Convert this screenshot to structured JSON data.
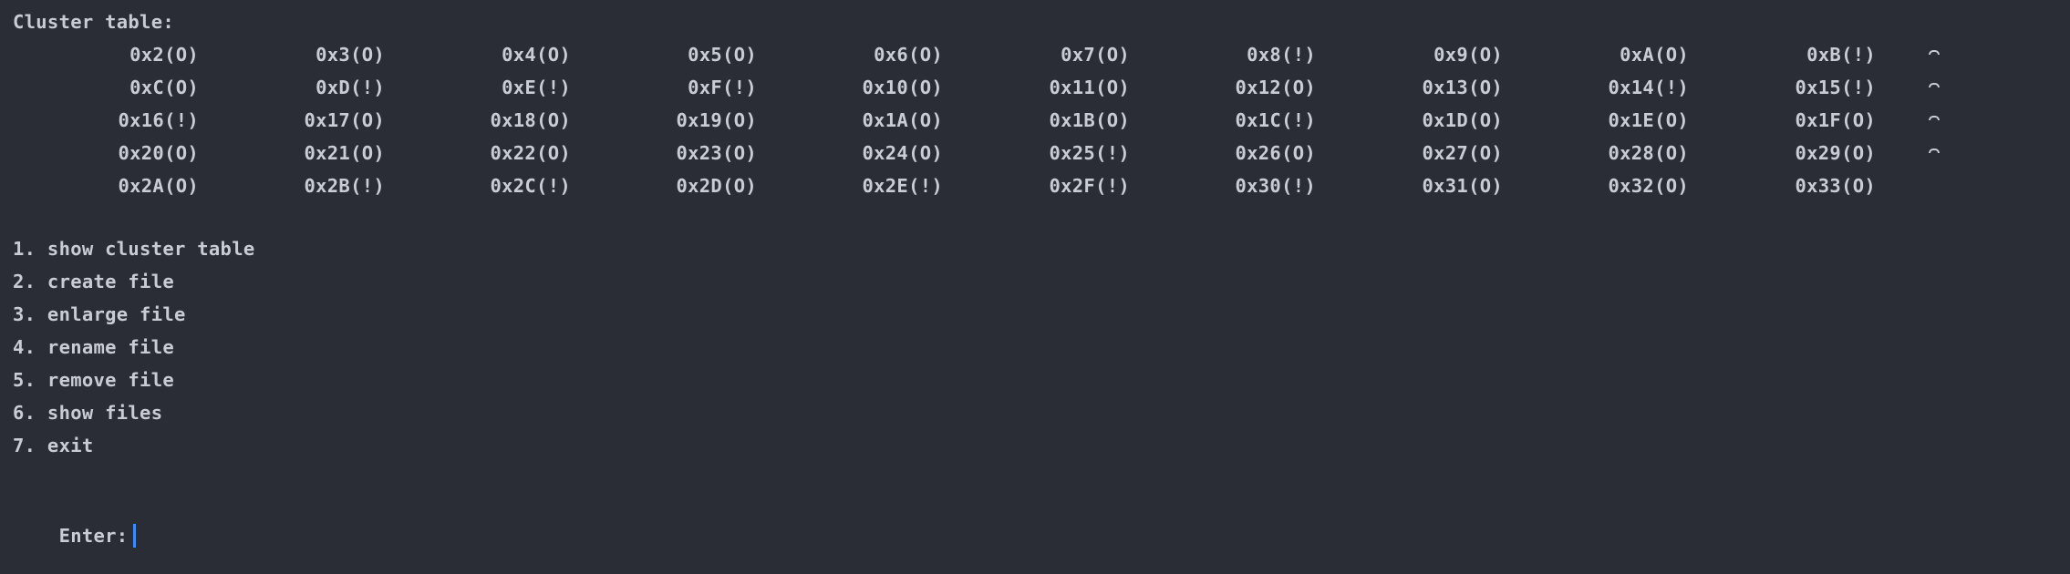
{
  "header": {
    "title": "Cluster table:"
  },
  "cluster_rows": [
    [
      "0x2(O)",
      "0x3(O)",
      "0x4(O)",
      "0x5(O)",
      "0x6(O)",
      "0x7(O)",
      "0x8(!)",
      "0x9(O)",
      "0xA(O)",
      "0xB(!)"
    ],
    [
      "0xC(O)",
      "0xD(!)",
      "0xE(!)",
      "0xF(!)",
      "0x10(O)",
      "0x11(O)",
      "0x12(O)",
      "0x13(O)",
      "0x14(!)",
      "0x15(!)"
    ],
    [
      "0x16(!)",
      "0x17(O)",
      "0x18(O)",
      "0x19(O)",
      "0x1A(O)",
      "0x1B(O)",
      "0x1C(!)",
      "0x1D(O)",
      "0x1E(O)",
      "0x1F(O)"
    ],
    [
      "0x20(O)",
      "0x21(O)",
      "0x22(O)",
      "0x23(O)",
      "0x24(O)",
      "0x25(!)",
      "0x26(O)",
      "0x27(O)",
      "0x28(O)",
      "0x29(O)"
    ],
    [
      "0x2A(O)",
      "0x2B(!)",
      "0x2C(!)",
      "0x2D(O)",
      "0x2E(!)",
      "0x2F(!)",
      "0x30(!)",
      "0x31(O)",
      "0x32(O)",
      "0x33(O)"
    ]
  ],
  "menu": [
    "1. show cluster table",
    "2. create file",
    "3. enlarge file",
    "4. rename file",
    "5. remove file",
    "6. show files",
    "7. exit"
  ],
  "prompt": {
    "label": "Enter:"
  },
  "colors": {
    "background": "#2b2d36",
    "text": "#c9ccd4",
    "cursor": "#3d8bff"
  }
}
